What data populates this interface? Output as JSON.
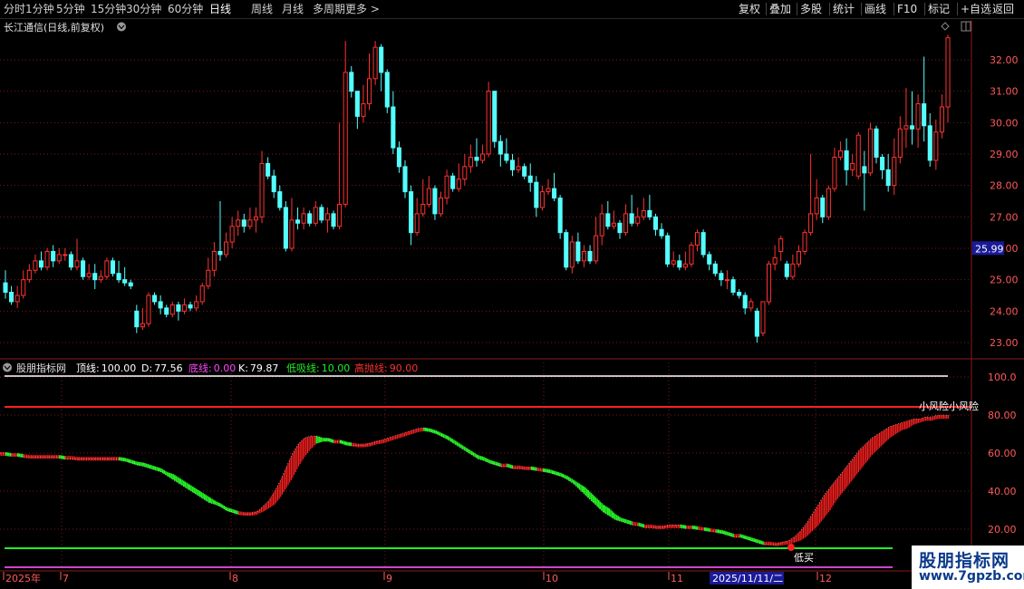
{
  "toolbar": {
    "left_items": [
      "分时",
      "1分钟",
      "5分钟",
      "15分钟",
      "30分钟",
      "60分钟",
      "日线",
      "周线",
      "月线",
      "多周期",
      "更多 >"
    ],
    "active_item": "日线",
    "right_items": [
      "复权",
      "叠加",
      "多股",
      "统计",
      "画线",
      "F10",
      "标记",
      "+自选",
      "返回"
    ]
  },
  "main_panel": {
    "title": "长江通信(日线,前复权)",
    "price_marker": "25.99",
    "y_ticks": [
      "32.00",
      "31.00",
      "30.00",
      "29.00",
      "28.00",
      "27.00",
      "26.00",
      "25.00",
      "24.00",
      "23.00"
    ]
  },
  "indicator_panel": {
    "name": "股朋指标网",
    "params": [
      {
        "label": "顶线:",
        "value": "100.00",
        "color": "#ffffff"
      },
      {
        "label": "D:",
        "value": "77.56",
        "color": "#ffffff"
      },
      {
        "label": "底线:",
        "value": "0.00",
        "color": "#ff44ff"
      },
      {
        "label": "K:",
        "value": "79.87",
        "color": "#ffffff"
      },
      {
        "label": "低吸线:",
        "value": "10.00",
        "color": "#22ee22"
      },
      {
        "label": "高抛线:",
        "value": "90.00",
        "color": "#ff3030"
      }
    ],
    "y_ticks": [
      "100.0",
      "80.00",
      "60.00",
      "40.00",
      "20.00"
    ],
    "annotation_high": "小风险小风险",
    "annotation_low": "低买"
  },
  "time_axis": {
    "labels": [
      "2025年",
      "7",
      "8",
      "9",
      "10",
      "11",
      "2025/11/11/二",
      "12"
    ]
  },
  "watermark": {
    "line1": "股朋指标网",
    "line2": "www.7gpzb.com"
  },
  "colors": {
    "up": "#ff3232",
    "down": "#54ffff",
    "green": "#22ee22",
    "red": "#ff2020",
    "bg": "#000000",
    "axis": "#8b1a1a"
  },
  "chart_data": {
    "type": "candlestick",
    "price_range": [
      22.8,
      32.9
    ],
    "candles": [
      [
        24.9,
        24.6,
        25.3,
        24.4
      ],
      [
        24.6,
        24.3,
        24.8,
        24.2
      ],
      [
        24.3,
        24.5,
        24.8,
        24.1
      ],
      [
        24.5,
        25.0,
        25.3,
        24.4
      ],
      [
        25.0,
        25.3,
        25.5,
        24.9
      ],
      [
        25.3,
        25.6,
        25.8,
        25.2
      ],
      [
        25.6,
        25.4,
        25.9,
        25.3
      ],
      [
        25.4,
        25.9,
        26.0,
        25.3
      ],
      [
        25.9,
        25.6,
        26.1,
        25.4
      ],
      [
        25.6,
        25.8,
        26.0,
        25.5
      ],
      [
        25.8,
        25.8,
        26.0,
        25.6
      ],
      [
        25.8,
        25.4,
        25.9,
        25.3
      ],
      [
        25.4,
        25.6,
        26.3,
        25.3
      ],
      [
        25.6,
        25.1,
        25.7,
        25.0
      ],
      [
        25.1,
        25.2,
        25.5,
        25.0
      ],
      [
        25.2,
        25.0,
        25.5,
        24.7
      ],
      [
        25.0,
        25.1,
        25.3,
        24.9
      ],
      [
        25.1,
        25.6,
        25.7,
        25.0
      ],
      [
        25.6,
        25.2,
        25.7,
        25.1
      ],
      [
        25.2,
        25.0,
        25.6,
        24.9
      ],
      [
        25.0,
        24.9,
        25.4,
        24.8
      ],
      [
        24.9,
        24.8,
        25.0,
        24.7
      ],
      [
        24.0,
        23.5,
        24.2,
        23.3
      ],
      [
        23.5,
        23.6,
        24.1,
        23.4
      ],
      [
        23.6,
        24.5,
        24.6,
        23.5
      ],
      [
        24.5,
        24.3,
        24.6,
        24.2
      ],
      [
        24.3,
        24.1,
        24.5,
        23.9
      ],
      [
        24.1,
        23.9,
        24.2,
        23.8
      ],
      [
        23.9,
        24.2,
        24.3,
        23.8
      ],
      [
        24.2,
        24.0,
        24.3,
        23.7
      ],
      [
        24.0,
        24.2,
        24.4,
        23.9
      ],
      [
        24.2,
        24.1,
        24.3,
        24.0
      ],
      [
        24.1,
        24.3,
        24.5,
        24.0
      ],
      [
        24.3,
        24.8,
        24.9,
        24.2
      ],
      [
        24.8,
        25.3,
        25.7,
        24.7
      ],
      [
        25.3,
        25.9,
        26.2,
        25.1
      ],
      [
        25.9,
        25.8,
        27.5,
        25.6
      ],
      [
        25.8,
        26.2,
        26.5,
        25.7
      ],
      [
        26.2,
        26.7,
        27.0,
        26.0
      ],
      [
        26.7,
        26.9,
        27.2,
        26.4
      ],
      [
        26.9,
        26.7,
        27.1,
        26.5
      ],
      [
        26.7,
        26.9,
        27.3,
        26.6
      ],
      [
        26.9,
        27.0,
        27.3,
        26.5
      ],
      [
        27.0,
        28.7,
        29.1,
        26.8
      ],
      [
        28.7,
        28.3,
        28.9,
        28.2
      ],
      [
        28.3,
        27.8,
        28.5,
        27.6
      ],
      [
        27.8,
        27.3,
        28.0,
        27.2
      ],
      [
        27.3,
        26.0,
        27.5,
        25.9
      ],
      [
        26.0,
        26.9,
        27.6,
        25.9
      ],
      [
        26.9,
        26.8,
        27.3,
        26.6
      ],
      [
        26.8,
        27.1,
        27.3,
        26.6
      ],
      [
        27.1,
        26.8,
        27.2,
        26.7
      ],
      [
        26.8,
        27.3,
        27.5,
        26.7
      ],
      [
        27.3,
        26.9,
        27.4,
        26.8
      ],
      [
        26.9,
        27.1,
        27.3,
        26.5
      ],
      [
        27.1,
        26.7,
        27.2,
        26.6
      ],
      [
        26.7,
        27.4,
        30.0,
        26.6
      ],
      [
        27.4,
        31.6,
        32.6,
        27.3
      ],
      [
        31.6,
        31.0,
        31.8,
        30.8
      ],
      [
        31.0,
        30.2,
        30.8,
        29.8
      ],
      [
        30.2,
        30.6,
        31.2,
        30.0
      ],
      [
        30.6,
        31.4,
        32.2,
        30.4
      ],
      [
        31.4,
        32.4,
        32.6,
        31.2
      ],
      [
        32.4,
        31.6,
        32.5,
        31.0
      ],
      [
        31.6,
        30.5,
        31.7,
        30.3
      ],
      [
        30.5,
        29.2,
        31.0,
        29.0
      ],
      [
        29.2,
        28.6,
        29.4,
        28.4
      ],
      [
        28.6,
        27.8,
        28.8,
        27.6
      ],
      [
        27.8,
        26.5,
        28.0,
        26.1
      ],
      [
        26.5,
        27.1,
        27.6,
        26.4
      ],
      [
        27.1,
        27.4,
        28.2,
        27.0
      ],
      [
        27.4,
        27.9,
        28.3,
        27.3
      ],
      [
        27.9,
        27.1,
        28.0,
        26.9
      ],
      [
        27.1,
        27.6,
        27.8,
        27.0
      ],
      [
        27.6,
        28.3,
        28.5,
        27.4
      ],
      [
        28.3,
        27.9,
        28.4,
        27.8
      ],
      [
        27.9,
        28.2,
        28.7,
        27.8
      ],
      [
        28.2,
        28.6,
        29.0,
        28.0
      ],
      [
        28.6,
        28.9,
        29.3,
        28.4
      ],
      [
        28.9,
        28.8,
        29.5,
        28.6
      ],
      [
        28.8,
        29.0,
        29.3,
        28.7
      ],
      [
        29.0,
        31.0,
        31.3,
        28.9
      ],
      [
        31.0,
        29.4,
        31.0,
        29.2
      ],
      [
        29.4,
        29.0,
        29.6,
        28.6
      ],
      [
        29.0,
        28.8,
        29.5,
        28.7
      ],
      [
        28.8,
        28.5,
        29.0,
        28.3
      ],
      [
        28.5,
        28.6,
        28.9,
        28.4
      ],
      [
        28.6,
        28.3,
        28.7,
        28.2
      ],
      [
        28.3,
        28.1,
        28.7,
        27.8
      ],
      [
        28.1,
        27.3,
        28.3,
        27.0
      ],
      [
        27.3,
        27.8,
        28.0,
        27.2
      ],
      [
        27.8,
        27.9,
        28.2,
        27.7
      ],
      [
        27.9,
        27.6,
        28.4,
        27.5
      ],
      [
        27.6,
        26.5,
        27.7,
        26.3
      ],
      [
        26.5,
        25.4,
        26.6,
        25.3
      ],
      [
        25.4,
        26.2,
        26.4,
        25.2
      ],
      [
        26.2,
        25.6,
        26.5,
        25.5
      ],
      [
        25.6,
        25.9,
        26.1,
        25.4
      ],
      [
        25.9,
        25.6,
        26.1,
        25.5
      ],
      [
        25.6,
        26.4,
        27.0,
        25.5
      ],
      [
        26.4,
        27.1,
        27.4,
        26.1
      ],
      [
        27.1,
        26.7,
        27.5,
        26.6
      ],
      [
        26.7,
        26.8,
        27.2,
        26.6
      ],
      [
        26.8,
        26.5,
        26.9,
        26.3
      ],
      [
        26.5,
        27.1,
        27.4,
        26.4
      ],
      [
        27.1,
        26.8,
        27.7,
        26.7
      ],
      [
        26.8,
        27.0,
        27.3,
        26.7
      ],
      [
        27.0,
        27.2,
        27.6,
        26.9
      ],
      [
        27.2,
        27.0,
        27.7,
        26.9
      ],
      [
        27.0,
        26.6,
        27.1,
        26.4
      ],
      [
        26.6,
        26.4,
        26.8,
        26.3
      ],
      [
        26.4,
        25.5,
        26.5,
        25.4
      ],
      [
        25.5,
        25.6,
        25.9,
        25.4
      ],
      [
        25.6,
        25.4,
        25.8,
        25.3
      ],
      [
        25.4,
        25.5,
        25.9,
        25.3
      ],
      [
        25.5,
        26.1,
        26.2,
        25.4
      ],
      [
        26.1,
        26.5,
        26.6,
        25.9
      ],
      [
        26.5,
        25.8,
        26.6,
        25.7
      ],
      [
        25.8,
        25.5,
        25.9,
        25.3
      ],
      [
        25.5,
        25.2,
        25.6,
        25.1
      ],
      [
        25.2,
        25.0,
        25.3,
        24.8
      ],
      [
        25.0,
        25.0,
        25.3,
        24.7
      ],
      [
        25.0,
        24.6,
        25.1,
        24.5
      ],
      [
        24.6,
        24.5,
        24.7,
        24.4
      ],
      [
        24.5,
        24.1,
        24.6,
        23.9
      ],
      [
        24.1,
        24.3,
        24.4,
        24.0
      ],
      [
        24.0,
        23.2,
        24.1,
        23.0
      ],
      [
        23.3,
        24.3,
        24.3,
        23.2
      ],
      [
        24.3,
        25.5,
        25.6,
        24.2
      ],
      [
        25.5,
        25.7,
        26.1,
        25.3
      ],
      [
        25.9,
        26.3,
        26.4,
        25.6
      ],
      [
        25.5,
        25.1,
        25.6,
        25.0
      ],
      [
        25.1,
        25.5,
        25.8,
        25.0
      ],
      [
        25.5,
        25.9,
        26.1,
        25.4
      ],
      [
        25.9,
        26.5,
        26.6,
        25.8
      ],
      [
        26.5,
        27.1,
        29.0,
        26.4
      ],
      [
        27.1,
        27.6,
        28.2,
        26.9
      ],
      [
        27.6,
        27.0,
        27.7,
        26.8
      ],
      [
        27.0,
        27.9,
        28.0,
        26.9
      ],
      [
        27.9,
        28.9,
        29.2,
        27.8
      ],
      [
        28.9,
        29.1,
        29.4,
        28.8
      ],
      [
        29.1,
        28.5,
        29.5,
        28.0
      ],
      [
        28.5,
        28.7,
        29.0,
        28.3
      ],
      [
        28.3,
        29.6,
        29.7,
        28.2
      ],
      [
        28.6,
        28.4,
        29.1,
        27.2
      ],
      [
        28.4,
        29.8,
        30.0,
        28.3
      ],
      [
        29.8,
        28.9,
        29.9,
        28.7
      ],
      [
        28.9,
        28.5,
        29.0,
        28.2
      ],
      [
        28.5,
        28.0,
        29.0,
        27.8
      ],
      [
        28.0,
        28.9,
        29.5,
        27.7
      ],
      [
        28.9,
        29.8,
        30.2,
        28.7
      ],
      [
        29.8,
        29.9,
        31.1,
        29.2
      ],
      [
        29.9,
        29.8,
        31.0,
        29.3
      ],
      [
        29.8,
        30.6,
        30.9,
        29.2
      ],
      [
        30.6,
        29.9,
        32.1,
        29.4
      ],
      [
        29.9,
        28.8,
        30.3,
        28.6
      ],
      [
        28.8,
        29.7,
        30.1,
        28.5
      ],
      [
        29.7,
        30.5,
        30.9,
        29.5
      ],
      [
        30.5,
        32.7,
        32.8,
        30.0
      ]
    ],
    "k_range": [
      0,
      100
    ],
    "k_series": [
      60,
      60,
      59,
      59,
      58,
      58,
      58,
      58,
      58,
      58,
      58,
      57,
      57,
      57,
      57,
      57,
      57,
      57,
      57,
      57,
      57,
      56,
      55,
      54,
      53,
      52,
      51,
      50,
      48,
      46,
      44,
      42,
      40,
      38,
      36,
      34,
      33,
      32,
      30,
      29,
      28,
      28,
      28,
      29,
      32,
      35,
      40,
      46,
      53,
      60,
      65,
      68,
      69,
      69,
      68,
      67,
      66,
      66,
      65,
      64,
      64,
      64,
      65,
      66,
      67,
      68,
      69,
      70,
      71,
      72,
      73,
      73,
      72,
      71,
      69,
      67,
      65,
      63,
      61,
      59,
      57,
      56,
      55,
      54,
      53,
      53,
      52,
      52,
      52,
      52,
      51,
      51,
      50,
      49,
      48,
      46,
      44,
      41,
      38,
      35,
      32,
      29,
      27,
      25,
      24,
      23,
      22,
      22,
      21,
      21,
      21,
      21,
      22,
      22,
      22,
      21,
      21,
      20,
      20,
      19,
      19,
      18,
      17,
      16,
      16,
      15,
      14,
      13,
      12,
      12,
      12,
      13,
      14,
      16,
      19,
      23,
      28,
      33,
      38,
      42,
      46,
      50,
      54,
      58,
      62,
      65,
      68,
      70,
      72,
      74,
      75,
      76,
      77,
      78,
      78,
      79,
      79,
      80,
      80,
      80
    ],
    "d_series": [
      59,
      59,
      59,
      59,
      59,
      58,
      58,
      58,
      58,
      58,
      58,
      58,
      58,
      57,
      57,
      57,
      57,
      57,
      57,
      57,
      57,
      57,
      56,
      55,
      55,
      54,
      53,
      52,
      50,
      49,
      47,
      45,
      43,
      41,
      39,
      37,
      35,
      33,
      31,
      30,
      29,
      28,
      28,
      28,
      29,
      31,
      33,
      37,
      42,
      47,
      53,
      58,
      62,
      65,
      66,
      67,
      66,
      66,
      65,
      65,
      64,
      64,
      64,
      65,
      65,
      66,
      67,
      68,
      69,
      70,
      71,
      72,
      72,
      71,
      70,
      69,
      67,
      65,
      63,
      61,
      59,
      58,
      56,
      55,
      54,
      54,
      53,
      53,
      52,
      52,
      52,
      51,
      51,
      50,
      49,
      48,
      46,
      44,
      42,
      39,
      36,
      33,
      31,
      28,
      26,
      25,
      24,
      23,
      22,
      22,
      21,
      21,
      21,
      21,
      21,
      21,
      21,
      21,
      20,
      20,
      19,
      19,
      18,
      17,
      17,
      16,
      15,
      14,
      13,
      13,
      12,
      12,
      12,
      13,
      14,
      16,
      19,
      22,
      26,
      30,
      35,
      39,
      43,
      47,
      51,
      55,
      59,
      62,
      65,
      68,
      70,
      72,
      73,
      75,
      76,
      77,
      77,
      78,
      78,
      78
    ]
  }
}
